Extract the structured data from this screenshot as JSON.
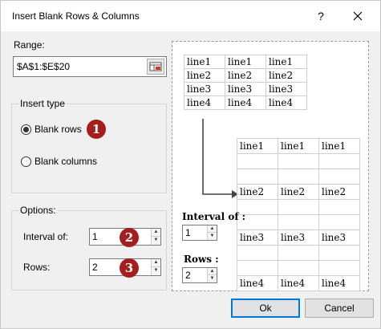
{
  "window": {
    "title": "Insert Blank Rows & Columns",
    "help_label": "?"
  },
  "range": {
    "label": "Range:",
    "value": "$A$1:$E$20"
  },
  "insert_type": {
    "title": "Insert type",
    "options": [
      "Blank rows",
      "Blank columns"
    ],
    "selected": "Blank rows"
  },
  "options": {
    "title": "Options:",
    "interval_label": "Interval of:",
    "interval_value": "1",
    "rows_label": "Rows:",
    "rows_value": "2"
  },
  "badges": [
    "1",
    "2",
    "3"
  ],
  "badge_color": "#a51e1e",
  "preview": {
    "table_before": [
      [
        "line1",
        "line1",
        "line1"
      ],
      [
        "line2",
        "line2",
        "line2"
      ],
      [
        "line3",
        "line3",
        "line3"
      ],
      [
        "line4",
        "line4",
        "line4"
      ]
    ],
    "table_after": [
      [
        "line1",
        "line1",
        "line1"
      ],
      [
        "",
        "",
        ""
      ],
      [
        "",
        "",
        ""
      ],
      [
        "line2",
        "line2",
        "line2"
      ],
      [
        "",
        "",
        ""
      ],
      [
        "",
        "",
        ""
      ],
      [
        "line3",
        "line3",
        "line3"
      ],
      [
        "",
        "",
        ""
      ],
      [
        "",
        "",
        ""
      ],
      [
        "line4",
        "line4",
        "line4"
      ]
    ],
    "interval_label": "Interval of :",
    "interval_value": "1",
    "rows_label": "Rows :",
    "rows_value": "2"
  },
  "buttons": {
    "ok": "Ok",
    "cancel": "Cancel"
  },
  "icons": {
    "close": "close-icon",
    "range_select": "range-select-icon",
    "arrow": "down-right-arrow-icon"
  }
}
